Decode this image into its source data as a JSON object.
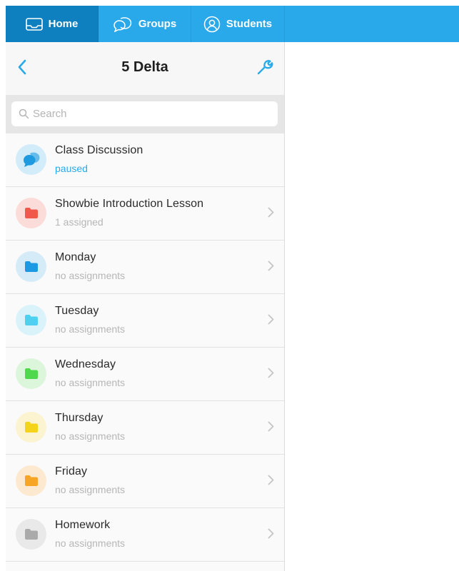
{
  "tabs": [
    {
      "label": "Home",
      "icon": "inbox-icon",
      "active": true
    },
    {
      "label": "Groups",
      "icon": "chat-bubbles-icon",
      "active": false
    },
    {
      "label": "Students",
      "icon": "person-icon",
      "active": false
    }
  ],
  "header": {
    "title": "5 Delta",
    "back_icon": "chevron-left-icon",
    "settings_icon": "wrench-icon"
  },
  "search": {
    "placeholder": "Search",
    "value": ""
  },
  "items": [
    {
      "title": "Class Discussion",
      "subtitle": "paused",
      "icon": "discussion-icon",
      "color": "#1e9be0",
      "bg": "#d3ecf9",
      "subtitle_color": "#2aa9ea",
      "chevron": false
    },
    {
      "title": "Showbie Introduction Lesson",
      "subtitle": "1 assigned",
      "icon": "folder-icon",
      "color": "#f0584b",
      "bg": "#fbdcd9",
      "subtitle_color": "#b6b6b6",
      "chevron": true
    },
    {
      "title": "Monday",
      "subtitle": "no assignments",
      "icon": "folder-icon",
      "color": "#1c99e2",
      "bg": "#d5ebf8",
      "subtitle_color": "#b6b6b6",
      "chevron": true
    },
    {
      "title": "Tuesday",
      "subtitle": "no assignments",
      "icon": "folder-icon",
      "color": "#4fd0f0",
      "bg": "#daf3fb",
      "subtitle_color": "#b6b6b6",
      "chevron": true
    },
    {
      "title": "Wednesday",
      "subtitle": "no assignments",
      "icon": "folder-icon",
      "color": "#4fd84b",
      "bg": "#dcf6db",
      "subtitle_color": "#b6b6b6",
      "chevron": true
    },
    {
      "title": "Thursday",
      "subtitle": "no assignments",
      "icon": "folder-icon",
      "color": "#f5d31a",
      "bg": "#fcf3d0",
      "subtitle_color": "#b6b6b6",
      "chevron": true
    },
    {
      "title": "Friday",
      "subtitle": "no assignments",
      "icon": "folder-icon",
      "color": "#f6a525",
      "bg": "#fde9cf",
      "subtitle_color": "#b6b6b6",
      "chevron": true
    },
    {
      "title": "Homework",
      "subtitle": "no assignments",
      "icon": "folder-icon",
      "color": "#aaaaaa",
      "bg": "#e9e9e9",
      "subtitle_color": "#b6b6b6",
      "chevron": true
    }
  ],
  "colors": {
    "accent": "#2aa9ea",
    "tab_active": "#0e80c0",
    "chevron": "#c4c4c4"
  }
}
